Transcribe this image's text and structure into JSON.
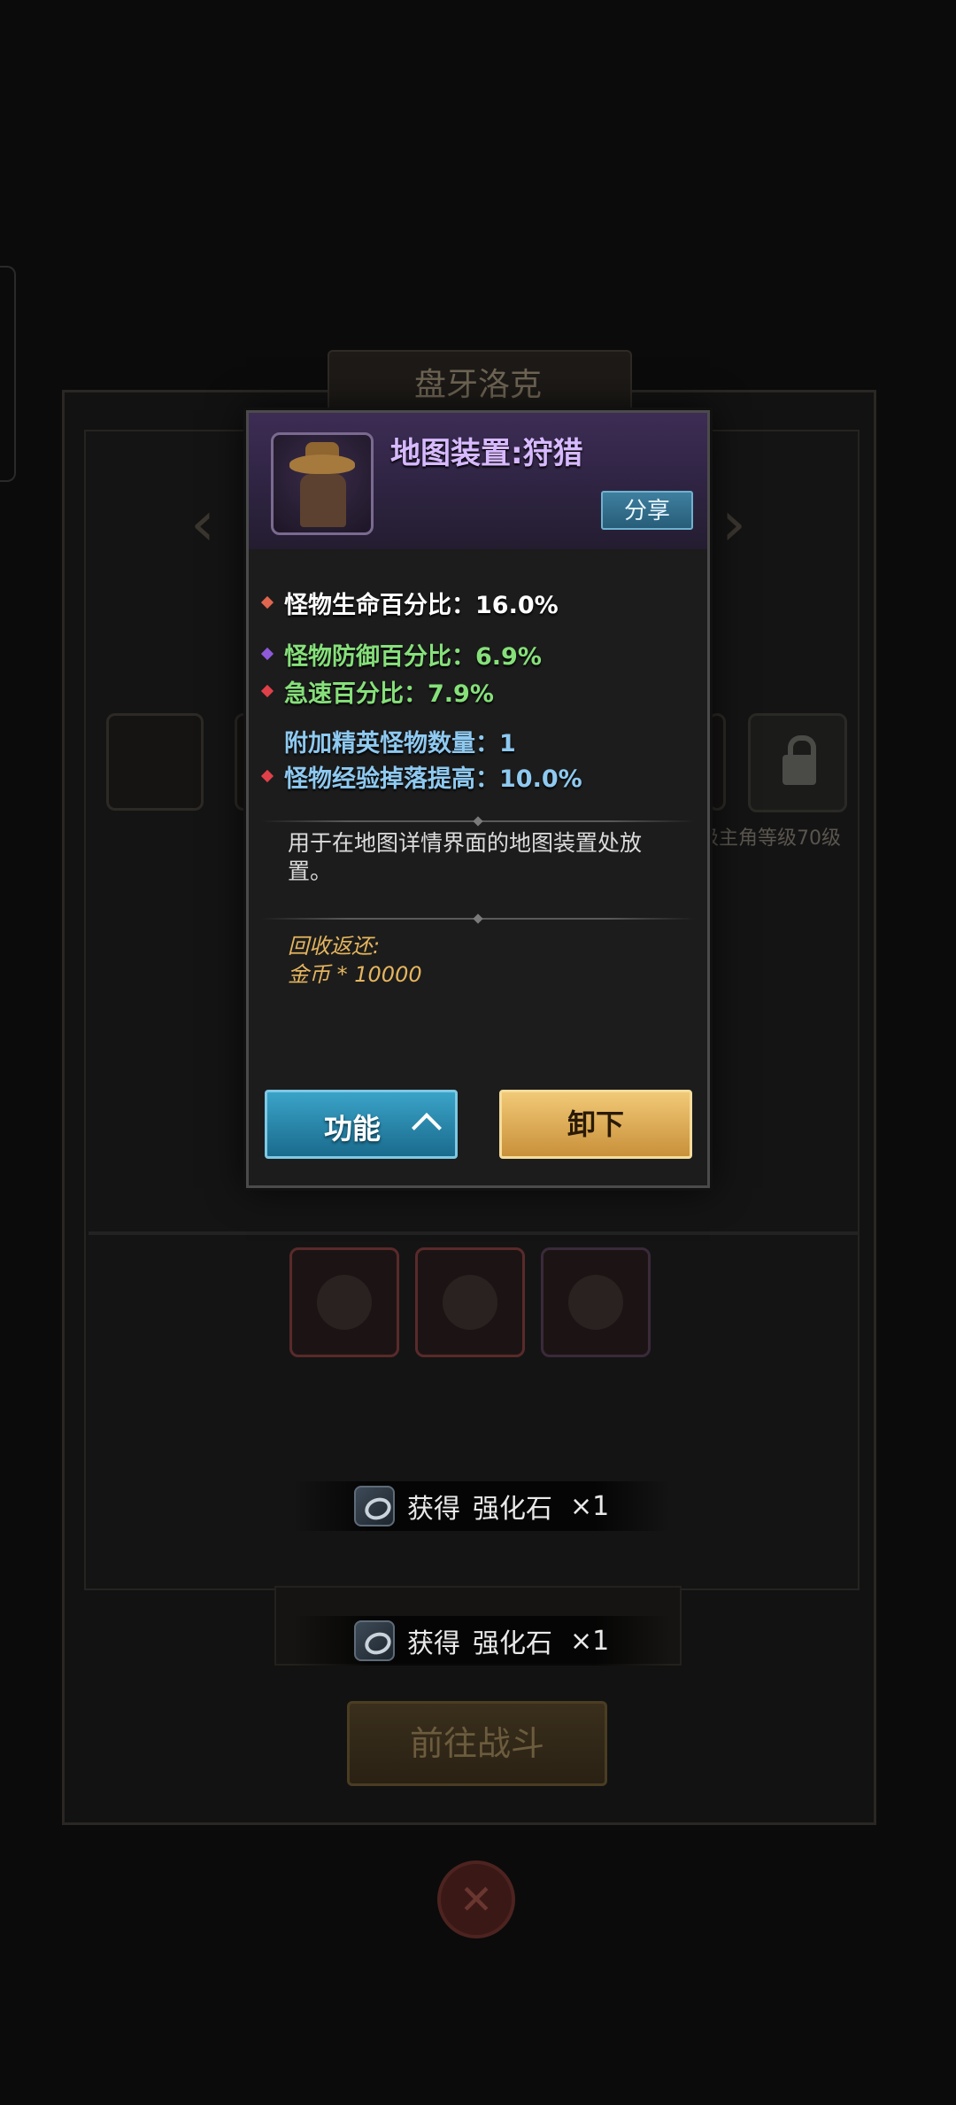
{
  "background": {
    "title": "盘牙洛克",
    "lock_label": "级主角等级70级",
    "go_button": "前往战斗"
  },
  "toasts": [
    {
      "prefix": "获得",
      "item": "强化石",
      "qty": "×1"
    },
    {
      "prefix": "获得",
      "item": "强化石",
      "qty": "×1"
    }
  ],
  "modal": {
    "title": "地图装置:狩猎",
    "share_label": "分享",
    "stats": [
      {
        "text": "怪物生命百分比：16.0%",
        "color": "#ffffff",
        "dot": "#e0664f"
      },
      {
        "text": "怪物防御百分比：6.9%",
        "color": "#86e07a",
        "dot": "#8e5ad8"
      },
      {
        "text": "急速百分比：7.9%",
        "color": "#86e07a",
        "dot": "#e0404a"
      },
      {
        "text": "附加精英怪物数量：1",
        "color": "#8ec9f0",
        "dot": null
      },
      {
        "text": "怪物经验掉落提高：10.0%",
        "color": "#8ec9f0",
        "dot": "#e0404a"
      }
    ],
    "description": "用于在地图详情界面的地图装置处放置。",
    "recycle_title": "回收返还:",
    "recycle_value": "金币 * 10000",
    "function_button": "功能",
    "unload_button": "卸下"
  }
}
